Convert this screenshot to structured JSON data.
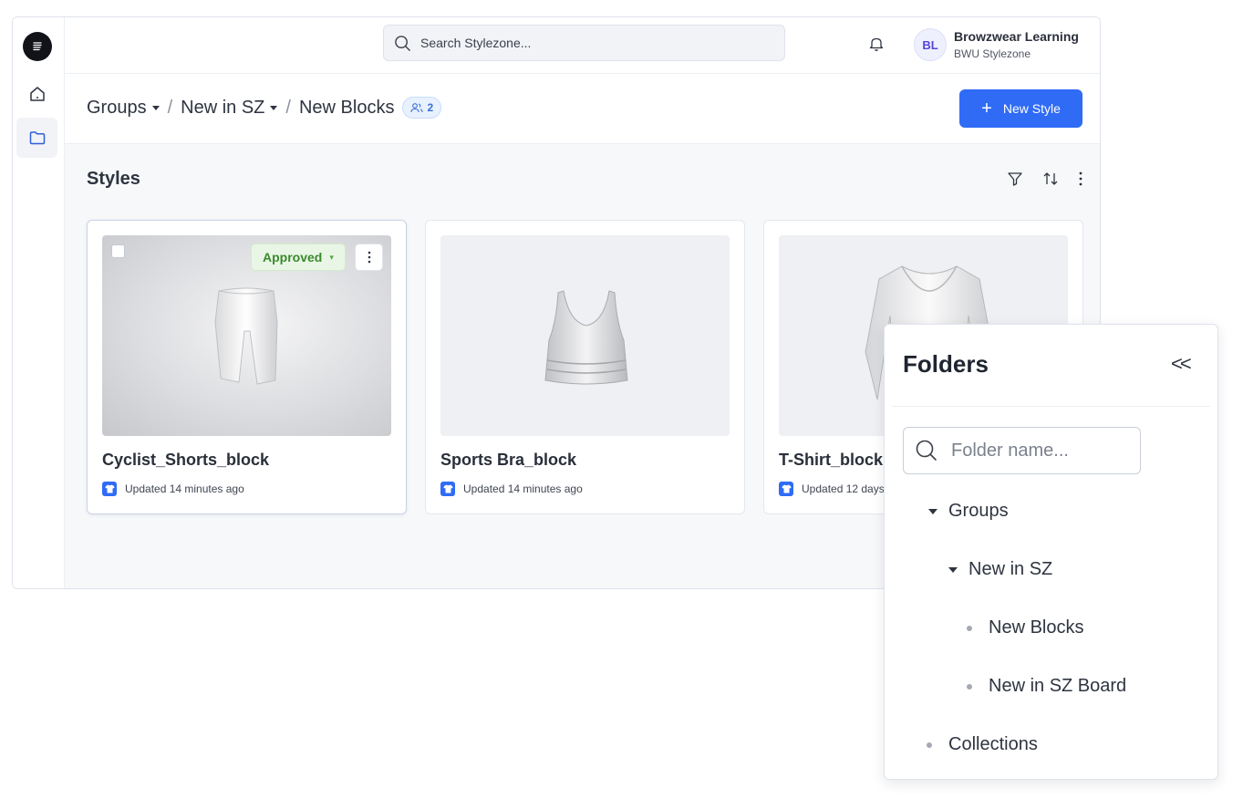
{
  "topbar": {
    "search_placeholder": "Search Stylezone...",
    "avatar_initials": "BL",
    "user_name": "Browzwear Learning",
    "user_sub": "BWU Stylezone"
  },
  "breadcrumb": {
    "items": [
      "Groups",
      "New in SZ",
      "New Blocks"
    ],
    "separator": "/",
    "members_count": "2"
  },
  "actions": {
    "new_style": "New Style"
  },
  "section": {
    "title": "Styles"
  },
  "cards": [
    {
      "title": "Cyclist_Shorts_block",
      "meta": "Updated 14 minutes ago",
      "status": "Approved"
    },
    {
      "title": "Sports Bra_block",
      "meta": "Updated 14 minutes ago"
    },
    {
      "title": "T-Shirt_block",
      "meta": "Updated 12 days"
    }
  ],
  "folders_panel": {
    "title": "Folders",
    "collapse_label": "<<",
    "search_placeholder": "Folder name...",
    "tree": [
      {
        "label": "Groups"
      },
      {
        "label": "New in SZ"
      },
      {
        "label": "New Blocks"
      },
      {
        "label": "New in SZ Board"
      },
      {
        "label": "Collections"
      }
    ]
  },
  "colors": {
    "accent": "#2f6bf5",
    "approved": "#3a8a2d"
  }
}
